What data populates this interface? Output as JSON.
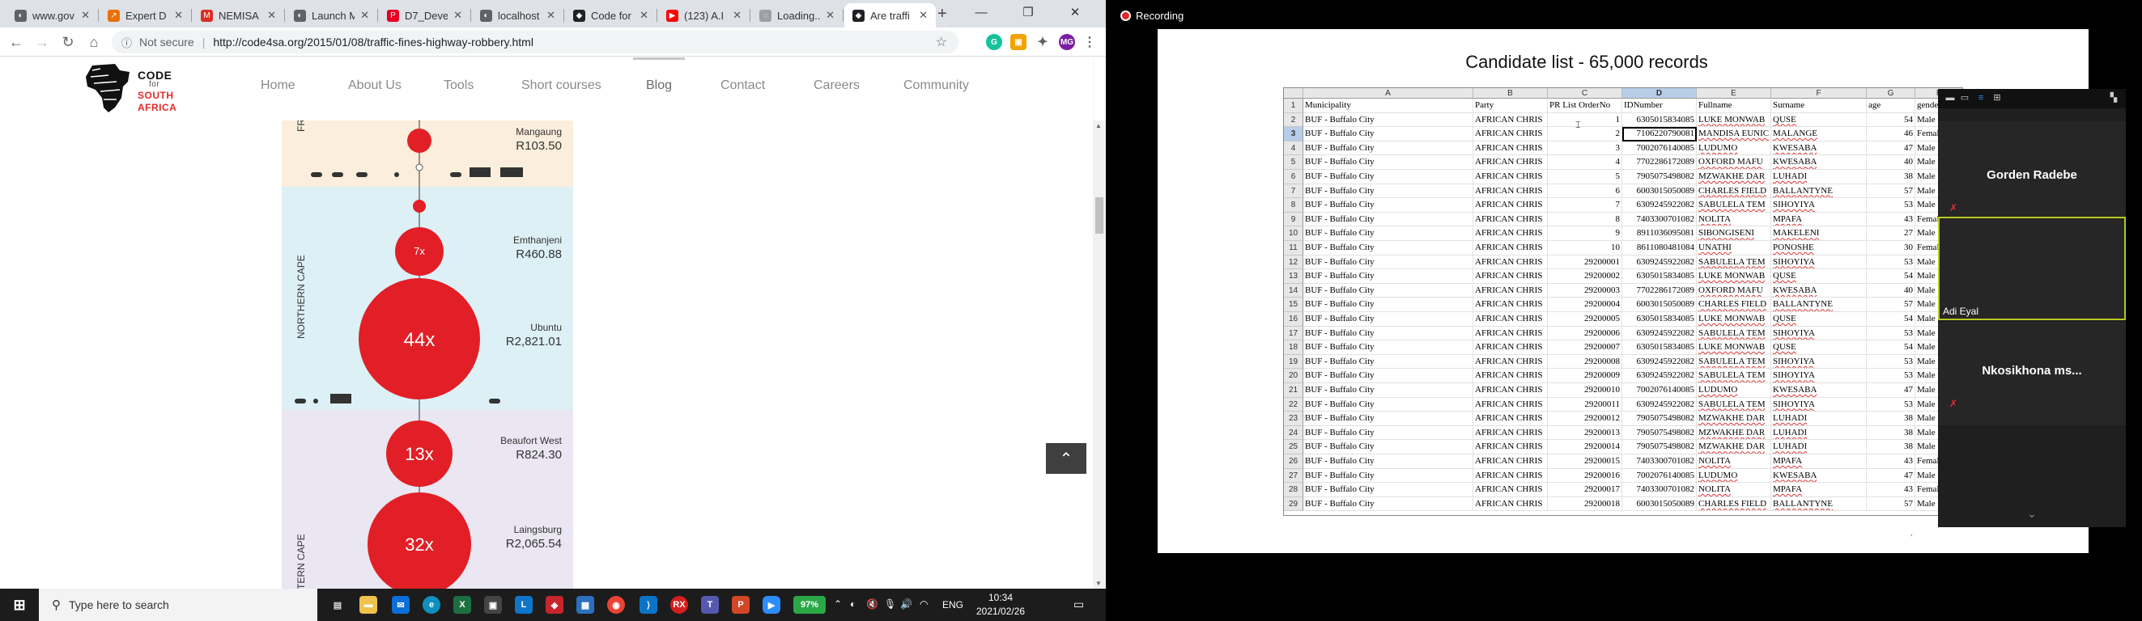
{
  "browser": {
    "tabs": [
      {
        "label": "www.gov",
        "color": "#5f6368",
        "glyph": "◐"
      },
      {
        "label": "Expert D",
        "color": "#e8710a",
        "glyph": "↗"
      },
      {
        "label": "NEMISA",
        "color": "#d93025",
        "glyph": "M"
      },
      {
        "label": "Launch M",
        "color": "#5f6368",
        "glyph": "◐"
      },
      {
        "label": "D7_Deve",
        "color": "#e60023",
        "glyph": "P"
      },
      {
        "label": "localhost",
        "color": "#5f6368",
        "glyph": "◐"
      },
      {
        "label": "Code for",
        "color": "#202124",
        "glyph": "◆"
      },
      {
        "label": "(123) A.I",
        "color": "#ff0000",
        "glyph": "▶"
      },
      {
        "label": "Loading...",
        "color": "#9aa0a6",
        "glyph": "◌"
      },
      {
        "label": "Are traffi",
        "color": "#202124",
        "glyph": "◆"
      }
    ],
    "new_tab": "+",
    "window_controls": {
      "minimize": "—",
      "restore": "❐",
      "close": "✕"
    },
    "not_secure": "Not secure",
    "url": "http://code4sa.org/2015/01/08/traffic-fines-highway-robbery.html",
    "profile": "MG"
  },
  "site": {
    "logo_top": "CODE",
    "logo_for": "for",
    "logo_bottom": "SOUTH AFRICA",
    "logo_colors": {
      "code": "#111111",
      "south": "#e02a2a",
      "africa": "#e02a2a"
    },
    "nav": [
      "Home",
      "About Us",
      "Tools",
      "Short courses",
      "Blog",
      "Contact",
      "Careers",
      "Community"
    ],
    "active_nav": "Blog"
  },
  "infographic": {
    "regions": [
      {
        "label": "FREE STATE",
        "partial": "FR",
        "color": "#fbeedc"
      },
      {
        "label": "NORTHERN CAPE",
        "color": "#ddf0f6"
      },
      {
        "label": "WESTERN CAPE",
        "partial": "TERN CAPE",
        "color": "#eae6f2"
      }
    ],
    "stops": [
      {
        "name": "Mangaung",
        "amount": "R103.50",
        "multiplier": ""
      },
      {
        "name": "Emthanjeni",
        "amount": "R460.88",
        "multiplier": "7x"
      },
      {
        "name": "Ubuntu",
        "amount": "R2,821.01",
        "multiplier": "44x"
      },
      {
        "name": "Beaufort West",
        "amount": "R824.30",
        "multiplier": "13x"
      },
      {
        "name": "Laingsburg",
        "amount": "R2,065.54",
        "multiplier": "32x"
      }
    ],
    "bubble_color": "#e21f26"
  },
  "taskbar": {
    "search_placeholder": "Type here to search",
    "battery": "97%",
    "lang": "ENG",
    "time": "10:34",
    "date": "2021/02/26"
  },
  "meeting": {
    "recording_label": "Recording",
    "share_title": "Candidate list - 65,000 records",
    "participants": [
      {
        "name": "Gorden Radebe",
        "muted": true,
        "speaking": false
      },
      {
        "name": "Adi Eyal",
        "muted": false,
        "speaking": true
      },
      {
        "name": "Nkosikhona  ms...",
        "muted": true,
        "speaking": false
      }
    ]
  },
  "spreadsheet": {
    "columns": [
      "A",
      "B",
      "C",
      "D",
      "E",
      "F",
      "G",
      "H"
    ],
    "selected_column": "D",
    "selected_row": 3,
    "header_row": [
      "Municipality",
      "Party",
      "PR List OrderNo",
      "IDNumber",
      "Fullname",
      "Surname",
      "age",
      "gender"
    ],
    "rows": [
      [
        "BUF - Buffalo City",
        "AFRICAN CHRIS",
        "1",
        "6305015834085",
        "LUKE MONWAB",
        "QUSE",
        "54",
        "Male"
      ],
      [
        "BUF - Buffalo City",
        "AFRICAN CHRIS",
        "2",
        "7106220790081",
        "MANDISA EUNIC",
        "MALANGE",
        "46",
        "Female"
      ],
      [
        "BUF - Buffalo City",
        "AFRICAN CHRIS",
        "3",
        "7002076140085",
        "LUDUMO",
        "KWESABA",
        "47",
        "Male"
      ],
      [
        "BUF - Buffalo City",
        "AFRICAN CHRIS",
        "4",
        "7702286172089",
        "OXFORD MAFU",
        "KWESABA",
        "40",
        "Male"
      ],
      [
        "BUF - Buffalo City",
        "AFRICAN CHRIS",
        "5",
        "7905075498082",
        "MZWAKHE DAR",
        "LUHADI",
        "38",
        "Male"
      ],
      [
        "BUF - Buffalo City",
        "AFRICAN CHRIS",
        "6",
        "6003015050089",
        "CHARLES FIELD",
        "BALLANTYNE",
        "57",
        "Male"
      ],
      [
        "BUF - Buffalo City",
        "AFRICAN CHRIS",
        "7",
        "6309245922082",
        "SABULELA TEM",
        "SIHOYIYA",
        "53",
        "Male"
      ],
      [
        "BUF - Buffalo City",
        "AFRICAN CHRIS",
        "8",
        "7403300701082",
        "NOLITA",
        "MPAFA",
        "43",
        "Female"
      ],
      [
        "BUF - Buffalo City",
        "AFRICAN CHRIS",
        "9",
        "8911036095081",
        "SIBONGISENI",
        "MAKELENI",
        "27",
        "Male"
      ],
      [
        "BUF - Buffalo City",
        "AFRICAN CHRIS",
        "10",
        "8611080481084",
        "UNATHI",
        "PONOSHE",
        "30",
        "Female"
      ],
      [
        "BUF - Buffalo City",
        "AFRICAN CHRIS",
        "29200001",
        "6309245922082",
        "SABULELA TEM",
        "SIHOYIYA",
        "53",
        "Male"
      ],
      [
        "BUF - Buffalo City",
        "AFRICAN CHRIS",
        "29200002",
        "6305015834085",
        "LUKE MONWAB",
        "QUSE",
        "54",
        "Male"
      ],
      [
        "BUF - Buffalo City",
        "AFRICAN CHRIS",
        "29200003",
        "7702286172089",
        "OXFORD MAFU",
        "KWESABA",
        "40",
        "Male"
      ],
      [
        "BUF - Buffalo City",
        "AFRICAN CHRIS",
        "29200004",
        "6003015050089",
        "CHARLES FIELD",
        "BALLANTYNE",
        "57",
        "Male"
      ],
      [
        "BUF - Buffalo City",
        "AFRICAN CHRIS",
        "29200005",
        "6305015834085",
        "LUKE MONWAB",
        "QUSE",
        "54",
        "Male"
      ],
      [
        "BUF - Buffalo City",
        "AFRICAN CHRIS",
        "29200006",
        "6309245922082",
        "SABULELA TEM",
        "SIHOYIYA",
        "53",
        "Male"
      ],
      [
        "BUF - Buffalo City",
        "AFRICAN CHRIS",
        "29200007",
        "6305015834085",
        "LUKE MONWAB",
        "QUSE",
        "54",
        "Male"
      ],
      [
        "BUF - Buffalo City",
        "AFRICAN CHRIS",
        "29200008",
        "6309245922082",
        "SABULELA TEM",
        "SIHOYIYA",
        "53",
        "Male"
      ],
      [
        "BUF - Buffalo City",
        "AFRICAN CHRIS",
        "29200009",
        "6309245922082",
        "SABULELA TEM",
        "SIHOYIYA",
        "53",
        "Male"
      ],
      [
        "BUF - Buffalo City",
        "AFRICAN CHRIS",
        "29200010",
        "7002076140085",
        "LUDUMO",
        "KWESABA",
        "47",
        "Male"
      ],
      [
        "BUF - Buffalo City",
        "AFRICAN CHRIS",
        "29200011",
        "6309245922082",
        "SABULELA TEM",
        "SIHOYIYA",
        "53",
        "Male"
      ],
      [
        "BUF - Buffalo City",
        "AFRICAN CHRIS",
        "29200012",
        "7905075498082",
        "MZWAKHE DAR",
        "LUHADI",
        "38",
        "Male"
      ],
      [
        "BUF - Buffalo City",
        "AFRICAN CHRIS",
        "29200013",
        "7905075498082",
        "MZWAKHE DAR",
        "LUHADI",
        "38",
        "Male"
      ],
      [
        "BUF - Buffalo City",
        "AFRICAN CHRIS",
        "29200014",
        "7905075498082",
        "MZWAKHE DAR",
        "LUHADI",
        "38",
        "Male"
      ],
      [
        "BUF - Buffalo City",
        "AFRICAN CHRIS",
        "29200015",
        "7403300701082",
        "NOLITA",
        "MPAFA",
        "43",
        "Female"
      ],
      [
        "BUF - Buffalo City",
        "AFRICAN CHRIS",
        "29200016",
        "7002076140085",
        "LUDUMO",
        "KWESABA",
        "47",
        "Male"
      ],
      [
        "BUF - Buffalo City",
        "AFRICAN CHRIS",
        "29200017",
        "7403300701082",
        "NOLITA",
        "MPAFA",
        "43",
        "Female"
      ],
      [
        "BUF - Buffalo City",
        "AFRICAN CHRIS",
        "29200018",
        "6003015050089",
        "CHARLES FIELD",
        "BALLANTYNE",
        "57",
        "Male"
      ]
    ]
  }
}
